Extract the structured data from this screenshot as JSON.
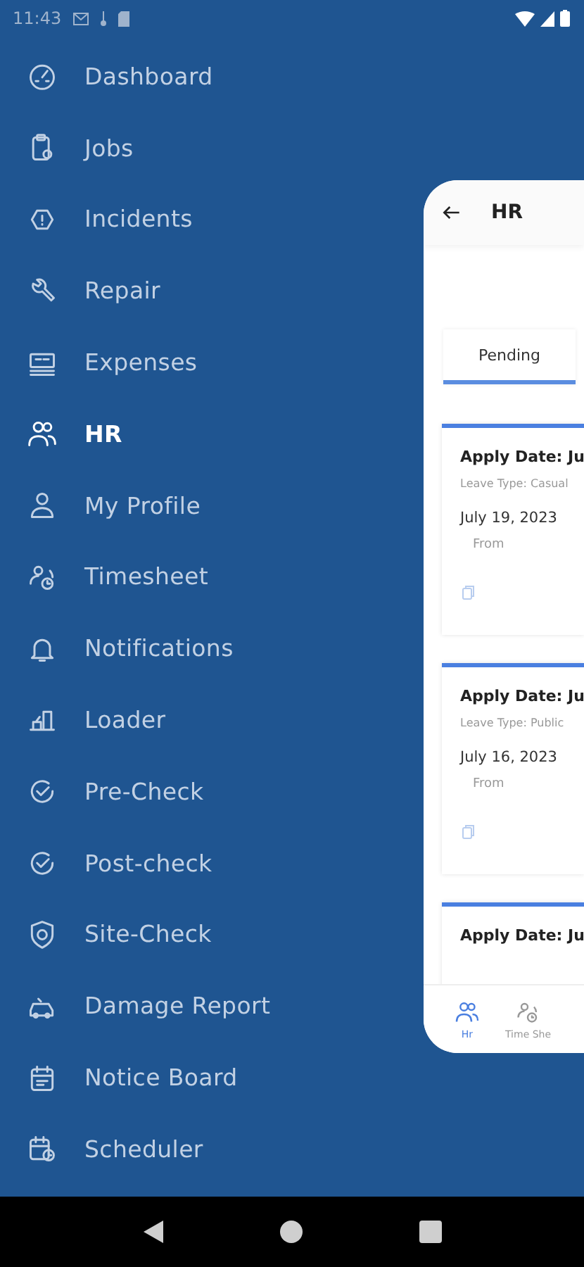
{
  "status_bar": {
    "time": "11:43"
  },
  "menu": [
    {
      "label": "Dashboard",
      "selected": false
    },
    {
      "label": "Jobs",
      "selected": false
    },
    {
      "label": "Incidents",
      "selected": false
    },
    {
      "label": "Repair",
      "selected": false
    },
    {
      "label": "Expenses",
      "selected": false
    },
    {
      "label": "HR",
      "selected": true
    },
    {
      "label": "My Profile",
      "selected": false
    },
    {
      "label": "Timesheet",
      "selected": false
    },
    {
      "label": "Notifications",
      "selected": false
    },
    {
      "label": "Loader",
      "selected": false
    },
    {
      "label": "Pre-Check",
      "selected": false
    },
    {
      "label": "Post-check",
      "selected": false
    },
    {
      "label": "Site-Check",
      "selected": false
    },
    {
      "label": "Damage Report",
      "selected": false
    },
    {
      "label": "Notice Board",
      "selected": false
    },
    {
      "label": "Scheduler",
      "selected": false
    }
  ],
  "preview": {
    "title": "HR",
    "tabs": [
      {
        "label": "Pending",
        "selected": true
      }
    ],
    "cards": [
      {
        "apply_date": "Apply Date: Ju",
        "leave_type": "Leave Type: Casual",
        "date": "July 19, 2023",
        "from": "From"
      },
      {
        "apply_date": "Apply Date: Ju",
        "leave_type": "Leave Type: Public",
        "date": "July 16, 2023",
        "from": "From"
      },
      {
        "apply_date": "Apply Date: Ju"
      }
    ],
    "bottom_nav": [
      {
        "label": "Hr",
        "selected": true
      },
      {
        "label": "Time She",
        "selected": false
      }
    ]
  }
}
